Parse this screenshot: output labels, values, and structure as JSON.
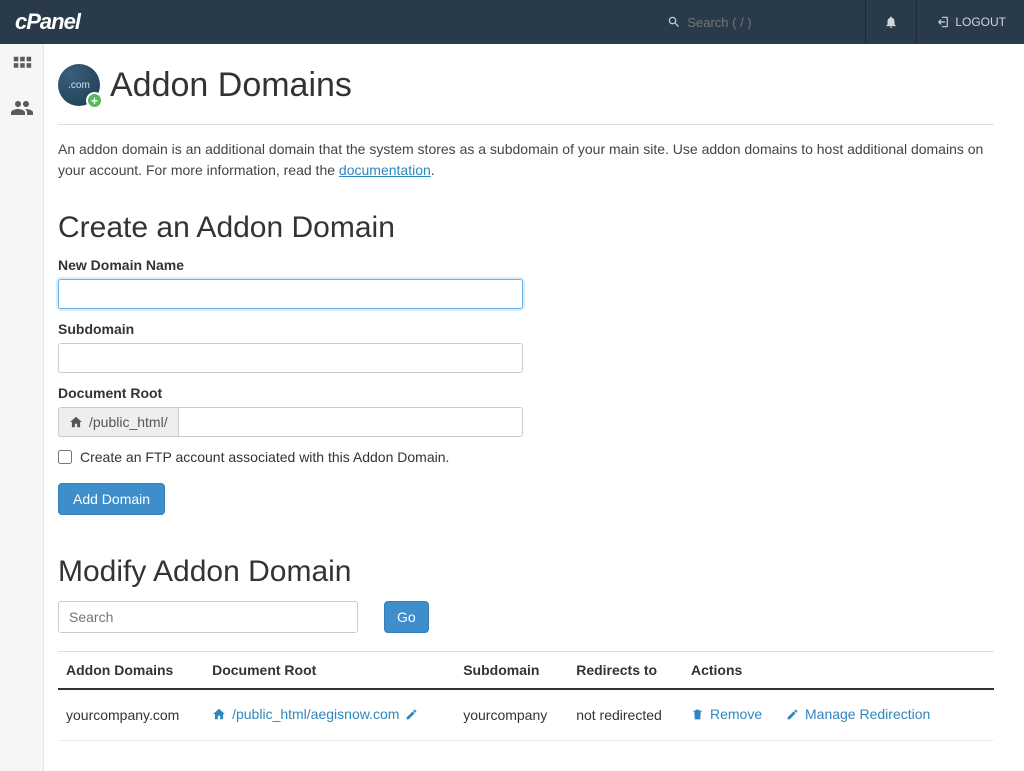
{
  "navbar": {
    "search_placeholder": "Search ( / )",
    "logout_label": "LOGOUT"
  },
  "page": {
    "title": "Addon Domains",
    "icon_label": ".com",
    "intro_text_1": "An addon domain is an additional domain that the system stores as a subdomain of your main site. Use addon domains to host additional domains on your account. For more information, read the ",
    "intro_link": "documentation",
    "intro_text_2": "."
  },
  "create": {
    "heading": "Create an Addon Domain",
    "new_domain_label": "New Domain Name",
    "subdomain_label": "Subdomain",
    "docroot_label": "Document Root",
    "docroot_prefix": "/public_html/",
    "ftp_checkbox_label": "Create an FTP account associated with this Addon Domain.",
    "submit_label": "Add Domain"
  },
  "modify": {
    "heading": "Modify Addon Domain",
    "search_placeholder": "Search",
    "go_label": "Go",
    "columns": {
      "addon": "Addon Domains",
      "docroot": "Document Root",
      "subdomain": "Subdomain",
      "redirects": "Redirects to",
      "actions": "Actions"
    },
    "rows": [
      {
        "addon": "yourcompany.com",
        "docroot": "/public_html/aegisnow.com",
        "subdomain": "yourcompany",
        "redirects": "not redirected"
      }
    ],
    "action_remove": "Remove",
    "action_manage": "Manage Redirection"
  }
}
